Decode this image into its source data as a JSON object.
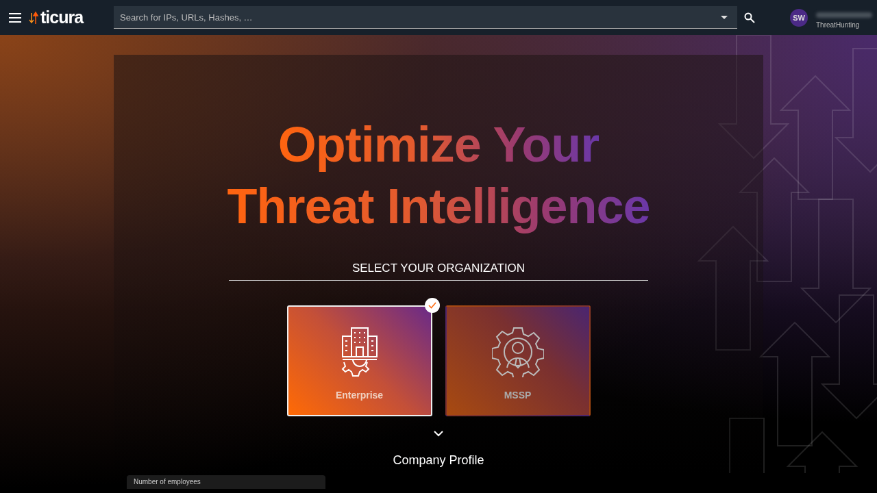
{
  "header": {
    "logo": "ticura",
    "search": {
      "placeholder": "Search for IPs, URLs, Hashes, …"
    },
    "user": {
      "initials": "SW",
      "role": "ThreatHunting"
    }
  },
  "hero": {
    "title_lines": [
      "Optimize Your",
      "Threat Intelligence"
    ]
  },
  "section_title": "SELECT YOUR ORGANIZATION",
  "organizations": [
    {
      "kind": "enterprise",
      "label": "Enterprise",
      "selected": true
    },
    {
      "kind": "mssp",
      "label": "MSSP",
      "selected": false
    }
  ],
  "profile": {
    "title": "Company Profile",
    "fields": [
      {
        "label": "Number of employees"
      }
    ]
  }
}
